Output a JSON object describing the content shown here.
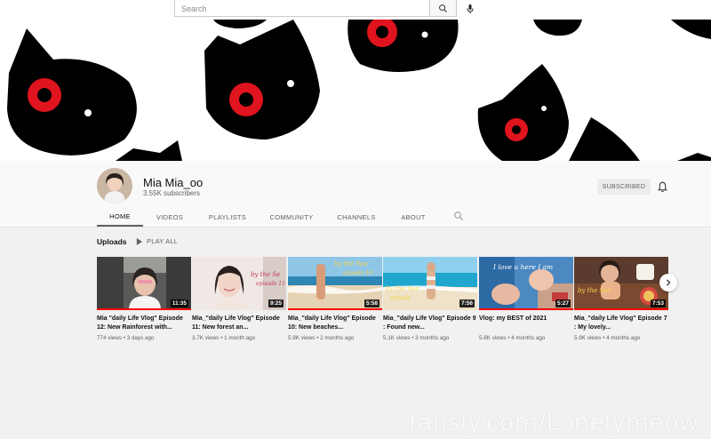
{
  "search": {
    "placeholder": "Search"
  },
  "channel": {
    "name": "Mia Mia_oo",
    "subscribers": "3.55K subscribers",
    "subscribe_label": "SUBSCRIBED"
  },
  "tabs": [
    {
      "label": "HOME"
    },
    {
      "label": "VIDEOS"
    },
    {
      "label": "PLAYLISTS"
    },
    {
      "label": "COMMUNITY"
    },
    {
      "label": "CHANNELS"
    },
    {
      "label": "ABOUT"
    }
  ],
  "uploads": {
    "title": "Uploads",
    "play_all": "PLAY ALL"
  },
  "videos": [
    {
      "title": "Mia \"daily Life Vlog\" Episode 12: New Rainforest with...",
      "views": "774 views",
      "age": "3 days ago",
      "duration": "11:35",
      "watched": 1.0
    },
    {
      "title": "Mia_\"daily Life Vlog\" Episode 11: New forest an...",
      "views": "3.7K views",
      "age": "1 month ago",
      "duration": "9:25",
      "watched": 0.0,
      "overlay": "by the Se episode 11"
    },
    {
      "title": "Mia_\"daily Life Vlog\" Episode 10: New beaches...",
      "views": "5.9K views",
      "age": "2 months ago",
      "duration": "5:58",
      "watched": 1.0,
      "overlay": "by the Sea episode 10"
    },
    {
      "title": "Mia_\"daily Life Vlog\" Episode 9 : Found new...",
      "views": "5.1K views",
      "age": "3 months ago",
      "duration": "7:56",
      "watched": 0.0,
      "overlay": "by the Sea episode"
    },
    {
      "title": "Vlog: my BEST of 2021",
      "views": "5.8K views",
      "age": "4 months ago",
      "duration": "5:27",
      "watched": 1.0,
      "overlay": "I love u here I am"
    },
    {
      "title": "Mia_\"daily Life Vlog\" Episode 7 : My lovely...",
      "views": "5.9K views",
      "age": "4 months ago",
      "duration": "7:53",
      "watched": 1.0,
      "overlay": "by the Sea"
    }
  ],
  "watermark": "fansly.com/Lonelymeow",
  "colors": {
    "accent": "#ff0000",
    "eye": "#e0141e",
    "cat": "#000000"
  }
}
